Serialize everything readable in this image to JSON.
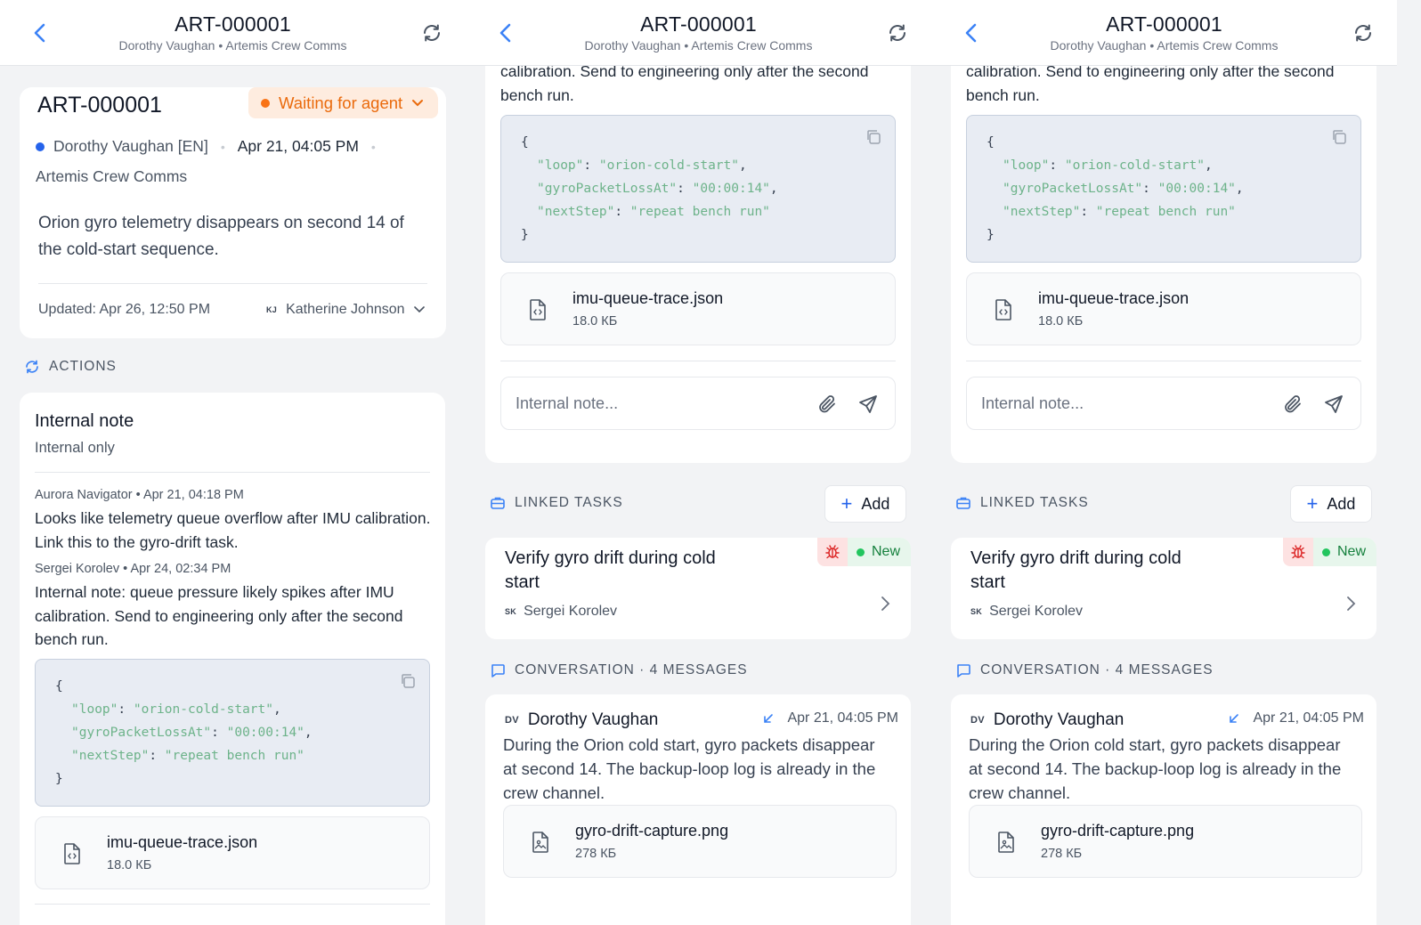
{
  "header": {
    "title": "ART-000001",
    "subtitle": "Dorothy Vaughan • Artemis Crew Comms"
  },
  "ticket": {
    "id": "ART-000001",
    "status": "Waiting for agent",
    "customer": "Dorothy Vaughan [EN]",
    "created": "Apr 21, 04:05 PM",
    "channel": "Artemis Crew Comms",
    "description": "Orion gyro telemetry disappears on second 14 of the cold-start sequence.",
    "updated": "Updated: Apr 26, 12:50 PM",
    "assignee_initials": "KJ",
    "assignee": "Katherine Johnson"
  },
  "actions": {
    "label": "ACTIONS",
    "internal_note": {
      "title": "Internal note",
      "subtitle": "Internal only",
      "entries": [
        {
          "meta": "Aurora Navigator • Apr 21, 04:18 PM",
          "text_lines": [
            "Looks like telemetry queue overflow after IMU calibration.",
            "Link this to the gyro-drift task."
          ]
        },
        {
          "meta": "Sergei Korolev • Apr 24, 02:34 PM",
          "text_lines": [
            "Internal note: queue pressure likely spikes after IMU",
            "calibration. Send to engineering only after the second",
            "bench run."
          ]
        }
      ],
      "code": {
        "open": "{",
        "close": "}",
        "lines": [
          {
            "key": "\"loop\"",
            "value": "\"orion-cold-start\"",
            "sep": ","
          },
          {
            "key": "\"gyroPacketLossAt\"",
            "value": "\"00:00:14\"",
            "sep": ","
          },
          {
            "key": "\"nextStep\"",
            "value": "\"repeat bench run\"",
            "sep": ""
          }
        ]
      },
      "attachment": {
        "name": "imu-queue-trace.json",
        "size": "18.0 КБ"
      },
      "input_placeholder": "Internal note..."
    }
  },
  "linked_tasks": {
    "label": "LINKED TASKS",
    "add_label": "Add",
    "tasks": [
      {
        "title_lines": [
          "Verify gyro drift during cold",
          "start"
        ],
        "status": "New",
        "assignee_initials": "SK",
        "assignee": "Sergei Korolev"
      }
    ]
  },
  "conversation": {
    "label": "CONVERSATION · 4 MESSAGES",
    "messages": [
      {
        "initials": "DV",
        "author": "Dorothy Vaughan",
        "time": "Apr 21, 04:05 PM",
        "text_lines": [
          "During the Orion cold start, gyro packets disappear",
          "at second 14. The backup-loop log is already in the",
          "crew channel."
        ],
        "attachment": {
          "name": "gyro-drift-capture.png",
          "size": "278 КБ"
        }
      }
    ]
  },
  "colors": {
    "accent": "#2563eb",
    "waiting": "#ea6a0c",
    "new_status": "#22c55e",
    "code_green": "#6db38a"
  },
  "icons": {
    "back": "chevron-left-icon",
    "refresh": "refresh-icon",
    "copy": "copy-icon",
    "file": "file-code-icon",
    "image_file": "file-image-icon",
    "attach": "paperclip-icon",
    "send": "send-icon",
    "bug": "bug-icon",
    "inbound": "arrow-down-left-icon",
    "tasks": "briefcase-icon",
    "conversation": "message-square-icon",
    "actions": "refresh-arrows-icon"
  }
}
